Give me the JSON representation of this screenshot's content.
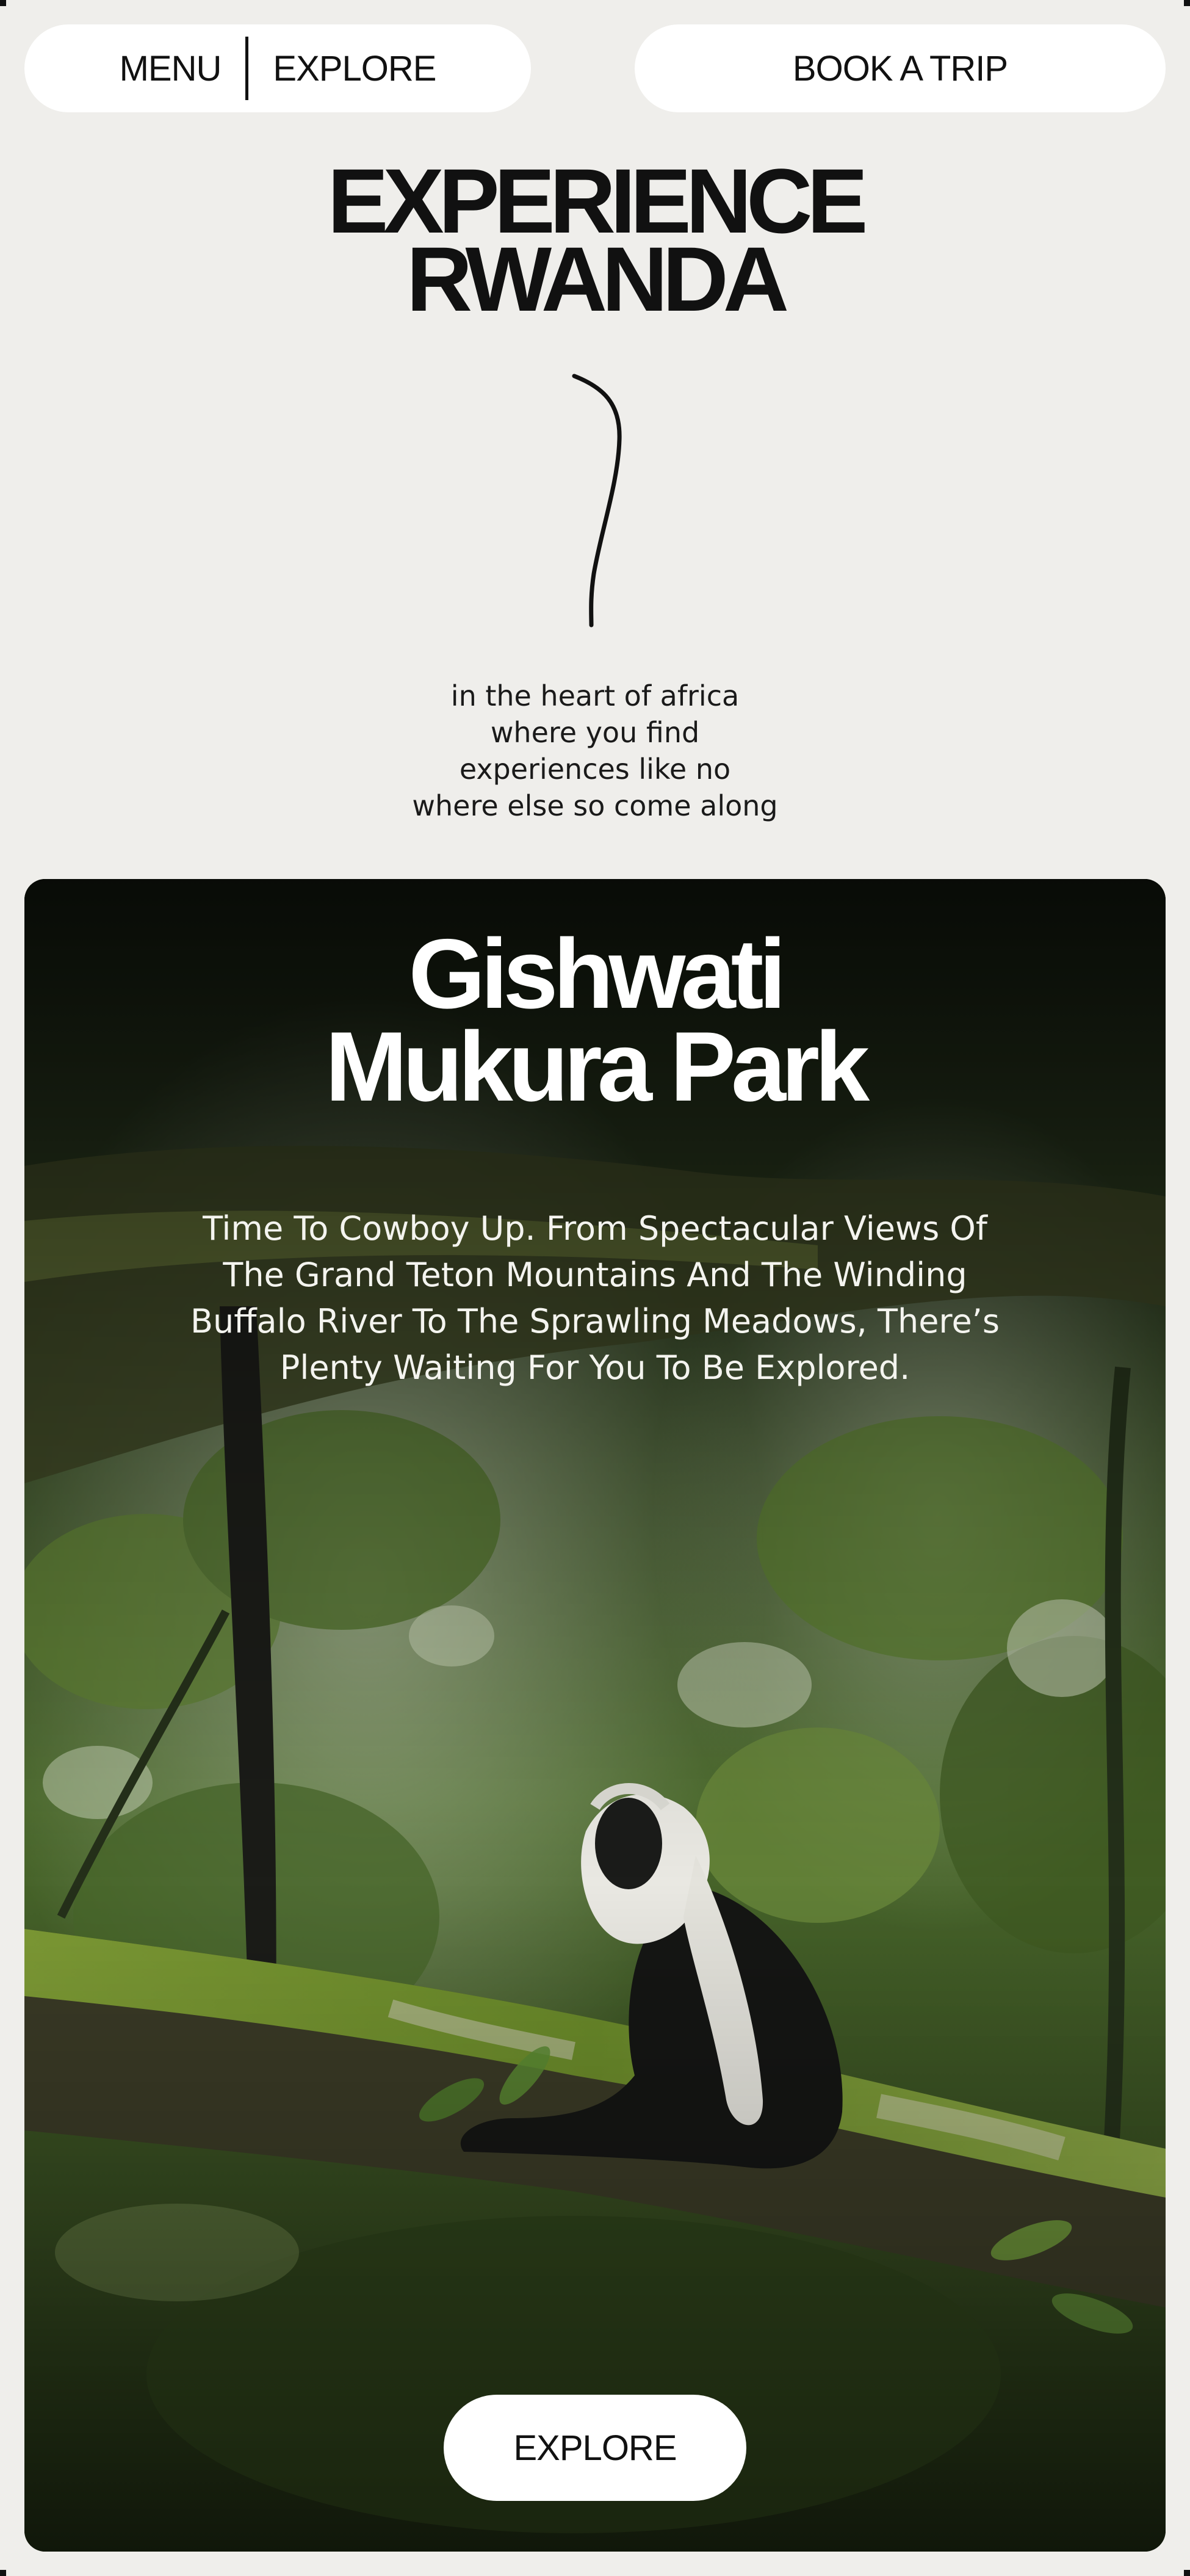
{
  "nav": {
    "menu_label": "MENU",
    "explore_label": "EXPLORE",
    "book_label": "BOOK A TRIP"
  },
  "hero": {
    "title_line1": "EXPERIENCE",
    "title_line2": "RWANDA",
    "tagline": [
      "in the heart of africa",
      "where you find",
      "experiences like no",
      "where else so come along"
    ]
  },
  "card": {
    "title_line1": "Gishwati",
    "title_line2": "Mukura Park",
    "description": [
      "Time To Cowboy Up. From Spectacular Views Of",
      "The Grand Teton Mountains And The Winding",
      "Buffalo River To The Sprawling Meadows, There’s",
      "Plenty Waiting For You To Be Explored."
    ],
    "button_label": "EXPLORE",
    "image_subject": "black-and-white colobus monkey on mossy branch"
  },
  "colors": {
    "page_bg": "#efeeeb",
    "pill_bg": "#ffffff",
    "text": "#111111",
    "forest_dark": "#1f2a14",
    "moss": "#6f8a2c"
  }
}
